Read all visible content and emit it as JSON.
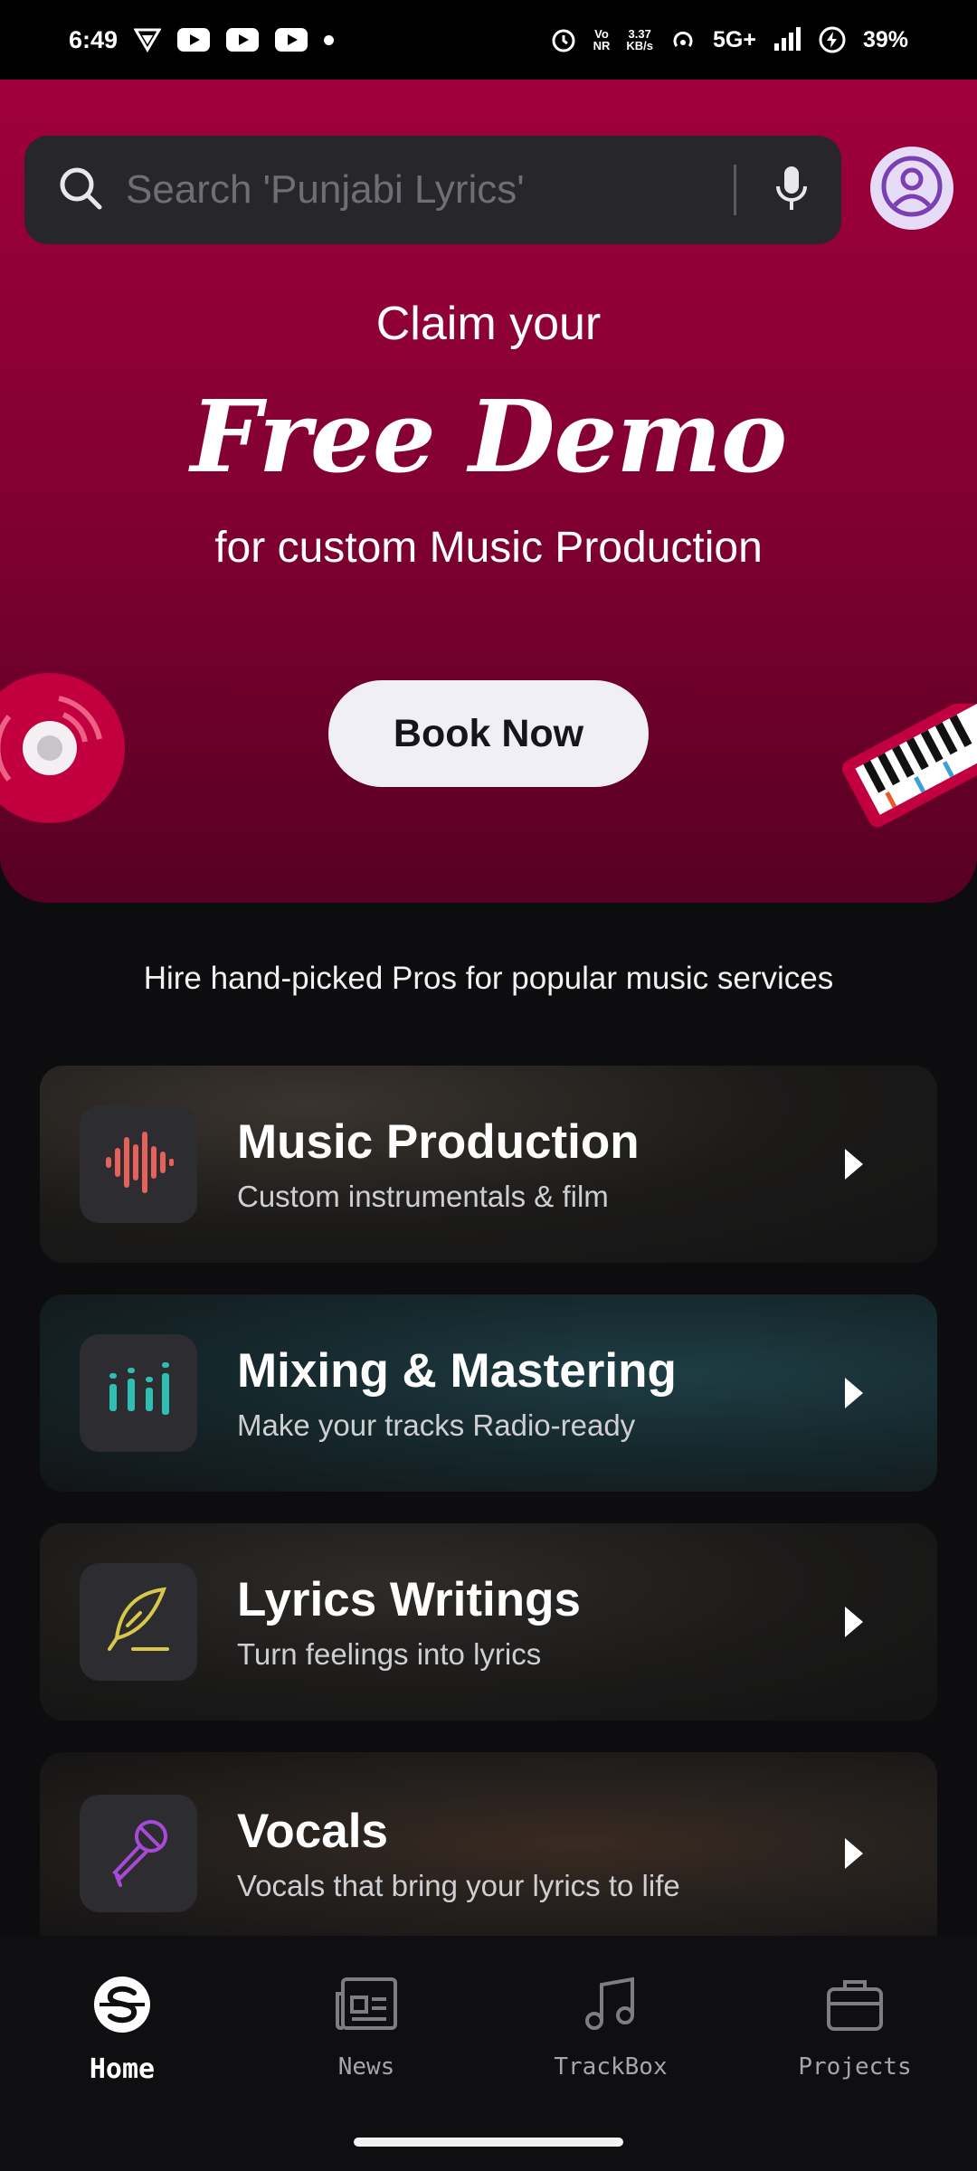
{
  "status_bar": {
    "time": "6:49",
    "battery": "39%",
    "network": "5G+",
    "speed_top": "3.37",
    "speed_bottom": "KB/s",
    "volte_top": "Vo",
    "volte_bottom": "NR"
  },
  "search": {
    "placeholder": "Search 'Punjabi Lyrics'"
  },
  "hero": {
    "claim": "Claim your",
    "headline": "Free Demo",
    "subline": "for custom Music Production",
    "button": "Book Now"
  },
  "services": {
    "tagline": "Hire hand-picked Pros for popular music services",
    "items": [
      {
        "title": "Music Production",
        "subtitle": "Custom instrumentals & film",
        "icon": "waveform-icon",
        "color": "#e5615a"
      },
      {
        "title": "Mixing & Mastering",
        "subtitle": "Make your tracks Radio-ready",
        "icon": "equalizer-icon",
        "color": "#2fbfb2"
      },
      {
        "title": "Lyrics Writings",
        "subtitle": "Turn feelings into lyrics",
        "icon": "quill-icon",
        "color": "#d7c84a"
      },
      {
        "title": "Vocals",
        "subtitle": "Vocals that bring your lyrics to life",
        "icon": "microphone-icon",
        "color": "#a64ad8"
      }
    ]
  },
  "nav": {
    "items": [
      {
        "label": "Home",
        "icon": "home-logo-icon",
        "active": true
      },
      {
        "label": "News",
        "icon": "news-icon"
      },
      {
        "label": "TrackBox",
        "icon": "music-note-icon"
      },
      {
        "label": "Projects",
        "icon": "briefcase-icon"
      }
    ]
  },
  "colors": {
    "accent": "#a0003c",
    "background": "#0d0d0f"
  }
}
